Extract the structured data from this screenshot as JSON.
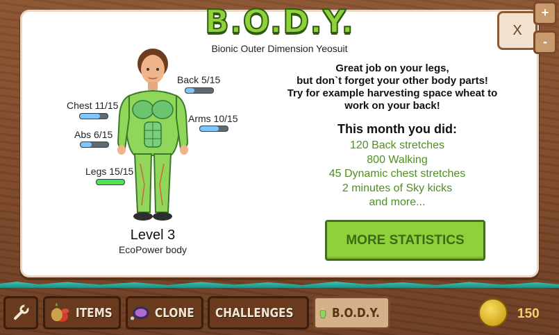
{
  "header": {
    "logo_text": "B.O.D.Y.",
    "subtitle": "Bionic Outer Dimension Yeosuit",
    "close_label": "X",
    "zoom_in_label": "+",
    "zoom_out_label": "-"
  },
  "avatar": {
    "stats": [
      {
        "label": "Back 5/15",
        "value": 5,
        "max": 15
      },
      {
        "label": "Chest 11/15",
        "value": 11,
        "max": 15
      },
      {
        "label": "Arms 10/15",
        "value": 10,
        "max": 15
      },
      {
        "label": "Abs 6/15",
        "value": 6,
        "max": 15
      },
      {
        "label": "Legs 15/15",
        "value": 15,
        "max": 15
      }
    ],
    "level": "Level 3",
    "body_type": "EcoPower body"
  },
  "message": {
    "lines": [
      "Great job on your legs,",
      "but don`t forget your other body parts!",
      "Try for example harvesting space wheat to",
      "work on your back!"
    ]
  },
  "month": {
    "heading": "This month you did:",
    "items": [
      "120 Back stretches",
      "800 Walking",
      "45 Dynamic chest stretches",
      "2 minutes of Sky kicks",
      "and more..."
    ]
  },
  "more_button": "MORE STATISTICS",
  "toolbar": {
    "items": [
      "ITEMS",
      "CLONE",
      "CHALLENGES",
      "B.O.D.Y."
    ],
    "coin_count": "150"
  },
  "colors": {
    "accent_green": "#8fd13a",
    "stat_bar_fill": "#7fc6ff",
    "stat_bar_full": "#4ee64e",
    "list_text": "#4f8f22"
  }
}
